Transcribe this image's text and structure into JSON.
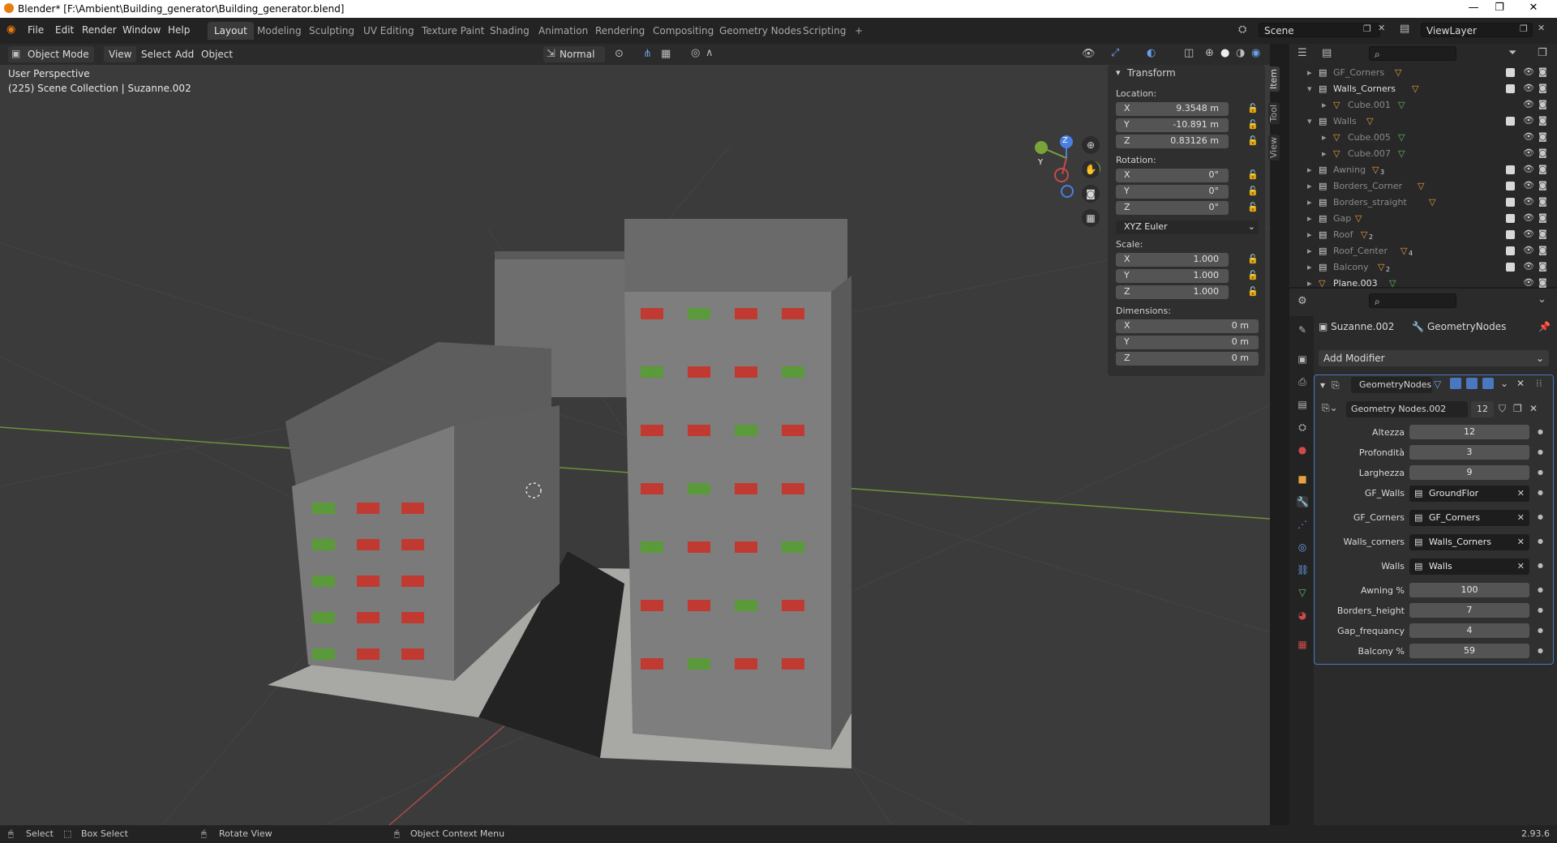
{
  "window": {
    "title": "Blender* [F:\\Ambient\\Building_generator\\Building_generator.blend]",
    "controls": [
      "—",
      "❐",
      "✕"
    ]
  },
  "menu": [
    "File",
    "Edit",
    "Render",
    "Window",
    "Help"
  ],
  "workspaces": [
    "Layout",
    "Modeling",
    "Sculpting",
    "UV Editing",
    "Texture Paint",
    "Shading",
    "Animation",
    "Rendering",
    "Compositing",
    "Geometry Nodes",
    "Scripting"
  ],
  "workspace_add": "+",
  "scene": {
    "name": "Scene",
    "view_layer": "ViewLayer"
  },
  "viewport_header": {
    "mode": "Object Mode",
    "menus": [
      "View",
      "Select",
      "Add",
      "Object"
    ],
    "orientation": "Normal"
  },
  "viewport": {
    "perspective": "User Perspective",
    "collection_info": "(225) Scene Collection | Suzanne.002",
    "gizmo_axes": {
      "z": "Z",
      "y": "Y"
    }
  },
  "npanel": {
    "tabs": [
      "Item",
      "Tool",
      "View"
    ],
    "section": "Transform",
    "location_label": "Location:",
    "location": [
      {
        "axis": "X",
        "value": "9.3548 m"
      },
      {
        "axis": "Y",
        "value": "-10.891 m"
      },
      {
        "axis": "Z",
        "value": "0.83126 m"
      }
    ],
    "rotation_label": "Rotation:",
    "rotation": [
      {
        "axis": "X",
        "value": "0°"
      },
      {
        "axis": "Y",
        "value": "0°"
      },
      {
        "axis": "Z",
        "value": "0°"
      }
    ],
    "rotation_mode": "XYZ Euler",
    "scale_label": "Scale:",
    "scale": [
      {
        "axis": "X",
        "value": "1.000"
      },
      {
        "axis": "Y",
        "value": "1.000"
      },
      {
        "axis": "Z",
        "value": "1.000"
      }
    ],
    "dimensions_label": "Dimensions:",
    "dimensions": [
      {
        "axis": "X",
        "value": "0 m"
      },
      {
        "axis": "Y",
        "value": "0 m"
      },
      {
        "axis": "Z",
        "value": "0 m"
      }
    ]
  },
  "outliner": {
    "rows": [
      {
        "name": "GF_Corners",
        "type": "collection-child",
        "dim": true,
        "badge": ""
      },
      {
        "name": "Walls_Corners",
        "type": "collection",
        "dim": false,
        "badge": ""
      },
      {
        "name": "Cube.001",
        "type": "object",
        "dim": true,
        "badge": ""
      },
      {
        "name": "Walls",
        "type": "collection",
        "dim": true,
        "badge": ""
      },
      {
        "name": "Cube.005",
        "type": "object",
        "dim": true,
        "badge": ""
      },
      {
        "name": "Cube.007",
        "type": "object",
        "dim": true,
        "badge": ""
      },
      {
        "name": "Awning",
        "type": "collection-child",
        "dim": true,
        "badge": "3"
      },
      {
        "name": "Borders_Corner",
        "type": "collection-child",
        "dim": true,
        "badge": ""
      },
      {
        "name": "Borders_straight",
        "type": "collection-child",
        "dim": true,
        "badge": ""
      },
      {
        "name": "Gap",
        "type": "collection-child",
        "dim": true,
        "badge": ""
      },
      {
        "name": "Roof",
        "type": "collection-child",
        "dim": true,
        "badge": "2"
      },
      {
        "name": "Roof_Center",
        "type": "collection-child",
        "dim": true,
        "badge": "4"
      },
      {
        "name": "Balcony",
        "type": "collection-child",
        "dim": true,
        "badge": "2"
      },
      {
        "name": "Plane.003",
        "type": "object",
        "dim": false,
        "badge": ""
      }
    ]
  },
  "properties": {
    "object": "Suzanne.002",
    "modifier_tab": "GeometryNodes",
    "add_modifier": "Add Modifier",
    "modifier_name": "GeometryNodes",
    "node_group": "Geometry Nodes.002",
    "users": "12",
    "inputs": [
      {
        "label": "Altezza",
        "kind": "num",
        "value": "12"
      },
      {
        "label": "Profondità",
        "kind": "num",
        "value": "3"
      },
      {
        "label": "Larghezza",
        "kind": "num",
        "value": "9"
      },
      {
        "label": "GF_Walls",
        "kind": "obj",
        "value": "GroundFlor"
      },
      {
        "label": "GF_Corners",
        "kind": "obj",
        "value": "GF_Corners"
      },
      {
        "label": "Walls_corners",
        "kind": "obj",
        "value": "Walls_Corners"
      },
      {
        "label": "Walls",
        "kind": "obj",
        "value": "Walls"
      },
      {
        "label": "Awning %",
        "kind": "num",
        "value": "100"
      },
      {
        "label": "Borders_height",
        "kind": "num",
        "value": "7"
      },
      {
        "label": "Gap_frequancy",
        "kind": "num",
        "value": "4"
      },
      {
        "label": "Balcony %",
        "kind": "num",
        "value": "59"
      }
    ]
  },
  "status": {
    "select": "Select",
    "box_select": "Box Select",
    "rotate": "Rotate View",
    "context": "Object Context Menu",
    "version": "2.93.6"
  }
}
